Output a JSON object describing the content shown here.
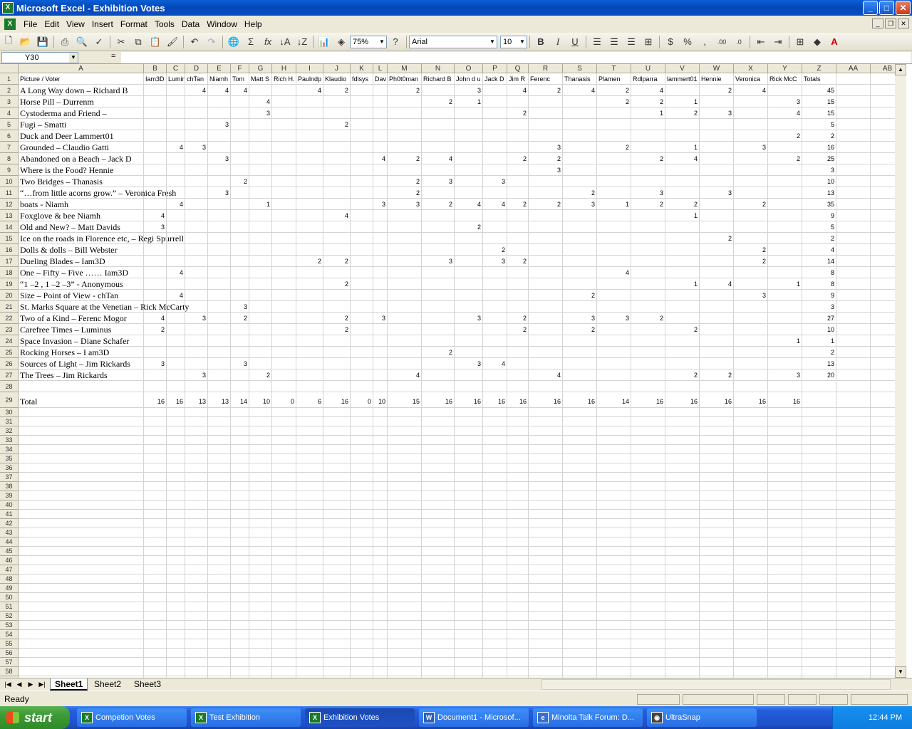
{
  "window": {
    "title": "Microsoft Excel - Exhibition Votes"
  },
  "menu": [
    "File",
    "Edit",
    "View",
    "Insert",
    "Format",
    "Tools",
    "Data",
    "Window",
    "Help"
  ],
  "toolbar": {
    "zoom": "75%",
    "font": "Arial",
    "size": "10"
  },
  "formula": {
    "namebox": "Y30",
    "fx": "=",
    "content": ""
  },
  "columns": [
    "A",
    "B",
    "C",
    "D",
    "E",
    "F",
    "G",
    "H",
    "I",
    "J",
    "K",
    "L",
    "M",
    "N",
    "O",
    "P",
    "Q",
    "R",
    "S",
    "T",
    "U",
    "V",
    "W",
    "X",
    "Y",
    "Z",
    "AA",
    "AB"
  ],
  "rows": [
    [
      "Picture / Voter",
      "Iam3D",
      "Lumin",
      "chTan",
      "Niamh",
      "Tom",
      "Matt S",
      "Rich H.",
      "Paulndp",
      "Klaudio",
      "fdlsys",
      "Dav",
      "Ph0t0man",
      "Richard B",
      "John d u",
      "Jack D",
      "Jim R",
      "Ferenc",
      "Thanasis",
      "Plamen",
      "Rdlparra",
      "lammert01",
      "Hennie",
      "Veronica",
      "Rick McC",
      "Totals"
    ],
    [
      "A Long Way down – Richard B",
      "",
      "",
      "4",
      "4",
      "4",
      "",
      "",
      "4",
      "2",
      "",
      "",
      "2",
      "",
      "3",
      "",
      "4",
      "2",
      "4",
      "2",
      "4",
      "",
      "2",
      "4",
      "",
      "45"
    ],
    [
      "Horse Pill – Durrenm",
      "",
      "",
      "",
      "",
      "",
      "4",
      "",
      "",
      "",
      "",
      "",
      "",
      "2",
      "1",
      "",
      "",
      "",
      "",
      "2",
      "2",
      "1",
      "",
      "",
      "3",
      "15"
    ],
    [
      "Cystoderma and Friend –",
      "",
      "",
      "",
      "",
      "",
      "3",
      "",
      "",
      "",
      "",
      "",
      "",
      "",
      "",
      "",
      "2",
      "",
      "",
      "",
      "1",
      "2",
      "3",
      "",
      "4",
      "15"
    ],
    [
      "Fugi – Smatti",
      "",
      "",
      "",
      "3",
      "",
      "",
      "",
      "",
      "2",
      "",
      "",
      "",
      "",
      "",
      "",
      "",
      "",
      "",
      "",
      "",
      "",
      "",
      "",
      "",
      "5"
    ],
    [
      "Duck and Deer Lammert01",
      "",
      "",
      "",
      "",
      "",
      "",
      "",
      "",
      "",
      "",
      "",
      "",
      "",
      "",
      "",
      "",
      "",
      "",
      "",
      "",
      "",
      "",
      "",
      "2",
      "2"
    ],
    [
      "Grounded – Claudio Gatti",
      "",
      "4",
      "3",
      "",
      "",
      "",
      "",
      "",
      "",
      "",
      "",
      "",
      "",
      "",
      "",
      "",
      "3",
      "",
      "2",
      "",
      "1",
      "",
      "3",
      "",
      "16"
    ],
    [
      "Abandoned on a Beach – Jack D",
      "",
      "",
      "",
      "3",
      "",
      "",
      "",
      "",
      "",
      "",
      "4",
      "2",
      "4",
      "",
      "",
      "2",
      "2",
      "",
      "",
      "2",
      "4",
      "",
      "",
      "2",
      "25"
    ],
    [
      "Where is the Food? Hennie",
      "",
      "",
      "",
      "",
      "",
      "",
      "",
      "",
      "",
      "",
      "",
      "",
      "",
      "",
      "",
      "",
      "3",
      "",
      "",
      "",
      "",
      "",
      "",
      "",
      "3"
    ],
    [
      "Two Bridges – Thanasis",
      "",
      "",
      "",
      "",
      "2",
      "",
      "",
      "",
      "",
      "",
      "",
      "2",
      "3",
      "",
      "3",
      "",
      "",
      "",
      "",
      "",
      "",
      "",
      "",
      "",
      "10"
    ],
    [
      "“…from little acorns grow.” – Veronica Fresh",
      "",
      "",
      "",
      "3",
      "",
      "",
      "",
      "",
      "",
      "",
      "",
      "2",
      "",
      "",
      "",
      "",
      "",
      "2",
      "",
      "3",
      "",
      "3",
      "",
      "",
      "13"
    ],
    [
      "boats - Niamh",
      "",
      "4",
      "",
      "",
      "",
      "1",
      "",
      "",
      "",
      "",
      "3",
      "3",
      "2",
      "4",
      "4",
      "2",
      "2",
      "3",
      "1",
      "2",
      "2",
      "",
      "2",
      "",
      "35"
    ],
    [
      "Foxglove & bee Niamh",
      "4",
      "",
      "",
      "",
      "",
      "",
      "",
      "",
      "4",
      "",
      "",
      "",
      "",
      "",
      "",
      "",
      "",
      "",
      "",
      "",
      "1",
      "",
      "",
      "",
      "9"
    ],
    [
      "Old and New? – Matt Davids",
      "3",
      "",
      "",
      "",
      "",
      "",
      "",
      "",
      "",
      "",
      "",
      "",
      "",
      "2",
      "",
      "",
      "",
      "",
      "",
      "",
      "",
      "",
      "",
      "",
      "5"
    ],
    [
      "Ice on the roads in Florence etc, – Regi Spurrell",
      "",
      "",
      "",
      "",
      "",
      "",
      "",
      "",
      "",
      "",
      "",
      "",
      "",
      "",
      "",
      "",
      "",
      "",
      "",
      "",
      "",
      "2",
      "",
      "",
      "2"
    ],
    [
      "Dolls & dolls – Bill Webster",
      "",
      "",
      "",
      "",
      "",
      "",
      "",
      "",
      "",
      "",
      "",
      "",
      "",
      "",
      "2",
      "",
      "",
      "",
      "",
      "",
      "",
      "",
      "2",
      "",
      "4"
    ],
    [
      "Dueling Blades – Iam3D",
      "",
      "",
      "",
      "",
      "",
      "",
      "",
      "2",
      "2",
      "",
      "",
      "",
      "3",
      "",
      "3",
      "2",
      "",
      "",
      "",
      "",
      "",
      "",
      "2",
      "",
      "14"
    ],
    [
      "One – Fifty – Five …… Iam3D",
      "",
      "4",
      "",
      "",
      "",
      "",
      "",
      "",
      "",
      "",
      "",
      "",
      "",
      "",
      "",
      "",
      "",
      "",
      "4",
      "",
      "",
      "",
      "",
      "",
      "8"
    ],
    [
      "“1 –2 , 1 –2 –3” -   Anonymous",
      "",
      "",
      "",
      "",
      "",
      "",
      "",
      "",
      "2",
      "",
      "",
      "",
      "",
      "",
      "",
      "",
      "",
      "",
      "",
      "",
      "1",
      "4",
      "",
      "1",
      "8"
    ],
    [
      "Size – Point of View -  chTan",
      "",
      "4",
      "",
      "",
      "",
      "",
      "",
      "",
      "",
      "",
      "",
      "",
      "",
      "",
      "",
      "",
      "",
      "2",
      "",
      "",
      "",
      "",
      "3",
      "",
      "9"
    ],
    [
      "St. Marks Square at the Venetian – Rick McCarty",
      "",
      "",
      "",
      "",
      "3",
      "",
      "",
      "",
      "",
      "",
      "",
      "",
      "",
      "",
      "",
      "",
      "",
      "",
      "",
      "",
      "",
      "",
      "",
      "",
      "3"
    ],
    [
      "Two of a Kind – Ferenc Mogor",
      "4",
      "",
      "3",
      "",
      "2",
      "",
      "",
      "",
      "2",
      "",
      "3",
      "",
      "",
      "3",
      "",
      "2",
      "",
      "3",
      "3",
      "2",
      "",
      "",
      "",
      "",
      "27"
    ],
    [
      "Carefree Times – Luminus",
      "2",
      "",
      "",
      "",
      "",
      "",
      "",
      "",
      "2",
      "",
      "",
      "",
      "",
      "",
      "",
      "2",
      "",
      "2",
      "",
      "",
      "2",
      "",
      "",
      "",
      "10"
    ],
    [
      "Space Invasion – Diane Schafer",
      "",
      "",
      "",
      "",
      "",
      "",
      "",
      "",
      "",
      "",
      "",
      "",
      "",
      "",
      "",
      "",
      "",
      "",
      "",
      "",
      "",
      "",
      "",
      "1",
      "1"
    ],
    [
      "Rocking Horses – I am3D",
      "",
      "",
      "",
      "",
      "",
      "",
      "",
      "",
      "",
      "",
      "",
      "",
      "2",
      "",
      "",
      "",
      "",
      "",
      "",
      "",
      "",
      "",
      "",
      "",
      "2"
    ],
    [
      "Sources of Light – Jim Rickards",
      "3",
      "",
      "",
      "",
      "3",
      "",
      "",
      "",
      "",
      "",
      "",
      "",
      "",
      "3",
      "4",
      "",
      "",
      "",
      "",
      "",
      "",
      "",
      "",
      "",
      "13"
    ],
    [
      "The Trees – Jim Rickards",
      "",
      "",
      "3",
      "",
      "",
      "2",
      "",
      "",
      "",
      "",
      "",
      "4",
      "",
      "",
      "",
      "",
      "4",
      "",
      "",
      "",
      "2",
      "2",
      "",
      "3",
      "20"
    ],
    [
      "",
      "",
      "",
      "",
      "",
      "",
      "",
      "",
      "",
      "",
      "",
      "",
      "",
      "",
      "",
      "",
      "",
      "",
      "",
      "",
      "",
      "",
      "",
      "",
      "",
      ""
    ],
    [
      "Total",
      "16",
      "16",
      "13",
      "13",
      "14",
      "10",
      "0",
      "6",
      "16",
      "0",
      "10",
      "15",
      "16",
      "16",
      "16",
      "16",
      "16",
      "16",
      "14",
      "16",
      "16",
      "16",
      "16",
      "16",
      ""
    ]
  ],
  "sheets": [
    "Sheet1",
    "Sheet2",
    "Sheet3"
  ],
  "status": "Ready",
  "taskbar": {
    "start": "start",
    "tasks": [
      "Competion Votes",
      "Test Exhibition",
      "Exhibition Votes",
      "Document1 - Microsof...",
      "Minolta Talk Forum: D...",
      "UltraSnap"
    ],
    "clock": "12:44 PM"
  }
}
